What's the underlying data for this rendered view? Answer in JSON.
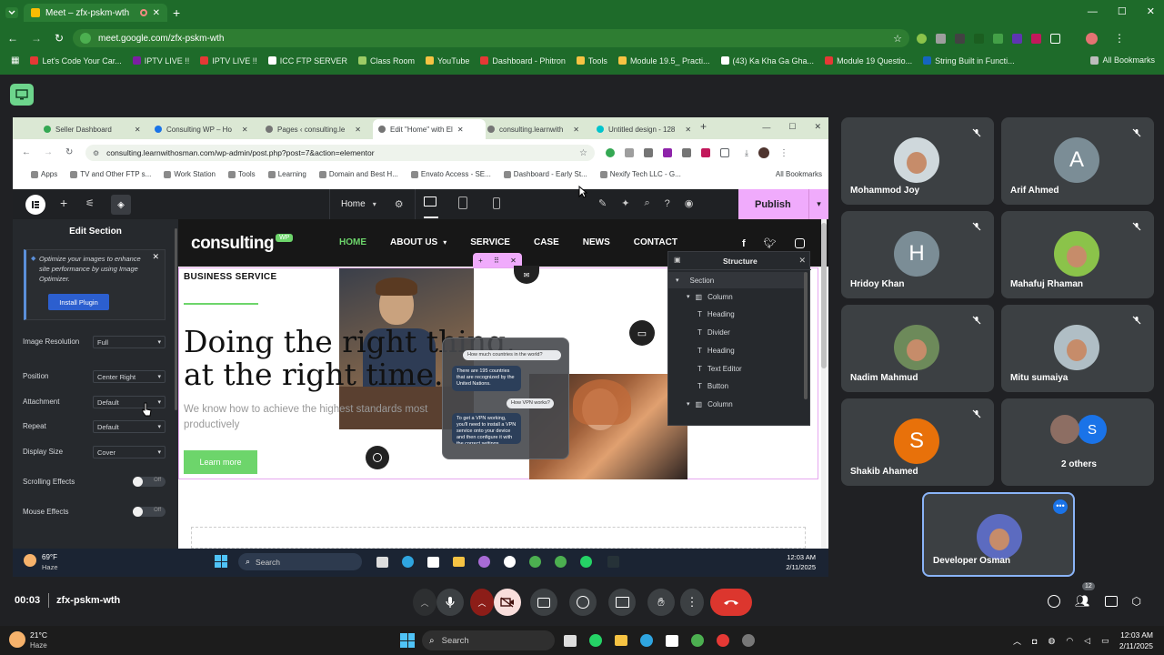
{
  "outer_browser": {
    "tab_title": "Meet – zfx-pskm-wth",
    "url": "meet.google.com/zfx-pskm-wth",
    "bookmarks": [
      "Let's Code Your Car...",
      "IPTV LIVE !!",
      "IPTV LIVE !!",
      "ICC FTP SERVER",
      "Class Room",
      "YouTube",
      "Dashboard - Phitron",
      "Tools",
      "Module 19.5_ Practi...",
      "(43) Ka Kha Ga Gha...",
      "Module 19 Questio...",
      "String Built in Functi..."
    ],
    "all_bookmarks": "All Bookmarks"
  },
  "inner_browser": {
    "tabs": [
      "Seller Dashboard",
      "Consulting WP – Ho",
      "Pages ‹ consulting.le",
      "Edit \"Home\" with El",
      "consulting.learnwith",
      "Untitled design - 128"
    ],
    "url": "consulting.learnwithosman.com/wp-admin/post.php?post=7&action=elementor",
    "bookmarks": [
      "Apps",
      "TV and Other FTP s...",
      "Work Station",
      "Tools",
      "Learning",
      "Domain and Best H...",
      "Envato Access - SE...",
      "Dashboard - Early St...",
      "Nexify Tech LLC - G..."
    ],
    "all_bookmarks": "All Bookmarks"
  },
  "elementor": {
    "page_select": "Home",
    "publish": "Publish",
    "panel_title": "Edit Section",
    "notice": "Optimize your images to enhance site performance by using Image Optimizer.",
    "install_plugin": "Install Plugin",
    "controls": [
      {
        "label": "Image Resolution",
        "value": "Full"
      },
      {
        "label": "Position",
        "value": "Center Right"
      },
      {
        "label": "Attachment",
        "value": "Default"
      },
      {
        "label": "Repeat",
        "value": "Default"
      },
      {
        "label": "Display Size",
        "value": "Cover"
      }
    ],
    "scrolling_effects": "Scrolling Effects",
    "mouse_effects": "Mouse Effects",
    "off": "Off"
  },
  "site": {
    "logo": "consulting",
    "logo_badge": "WP",
    "nav": [
      "HOME",
      "ABOUT US",
      "SERVICE",
      "CASE",
      "NEWS",
      "CONTACT"
    ],
    "eyebrow": "BUSINESS SERVICE",
    "headline_1": "Doing the right thing,",
    "headline_2": "at the right time.",
    "sub": "We know how to achieve the highest standards most productively",
    "cta": "Learn more",
    "chat": [
      "How much countries in the world?",
      "There are 195 countries that are recognized by the United Nations.",
      "How VPN works?",
      "To get a VPN working, you'll need to install a VPN service onto your device and then configure it with the correct settings."
    ]
  },
  "structure": {
    "title": "Structure",
    "items": [
      "Section",
      "Column",
      "Heading",
      "Divider",
      "Heading",
      "Text Editor",
      "Button",
      "Column"
    ]
  },
  "inner_taskbar": {
    "weather_temp": "69°F",
    "weather_desc": "Haze",
    "search": "Search",
    "time": "12:03 AM",
    "date": "2/11/2025"
  },
  "participants": [
    {
      "name": "Mohammod Joy",
      "initial": "",
      "color": "#cfd8dc"
    },
    {
      "name": "Arif Ahmed",
      "initial": "A",
      "color": "#7b8d96"
    },
    {
      "name": "Hridoy Khan",
      "initial": "H",
      "color": "#7b8d96"
    },
    {
      "name": "Mahafuj Rhaman",
      "initial": "",
      "color": "#8bc34a"
    },
    {
      "name": "Nadim Mahmud",
      "initial": "",
      "color": "#6d8a5a"
    },
    {
      "name": "Mitu sumaiya",
      "initial": "",
      "color": "#b0bec5"
    },
    {
      "name": "Shakib Ahamed",
      "initial": "S",
      "color": "#e8710a"
    },
    {
      "name": "2 others",
      "initial": "S",
      "color": "#1a73e8"
    },
    {
      "name": "Developer Osman",
      "initial": "",
      "color": "#5c6bc0"
    }
  ],
  "meeting": {
    "time": "00:03",
    "code": "zfx-pskm-wth",
    "people_count": "12"
  },
  "taskbar": {
    "temp": "21°C",
    "desc": "Haze",
    "search": "Search",
    "time": "12:03 AM",
    "date": "2/11/2025"
  }
}
